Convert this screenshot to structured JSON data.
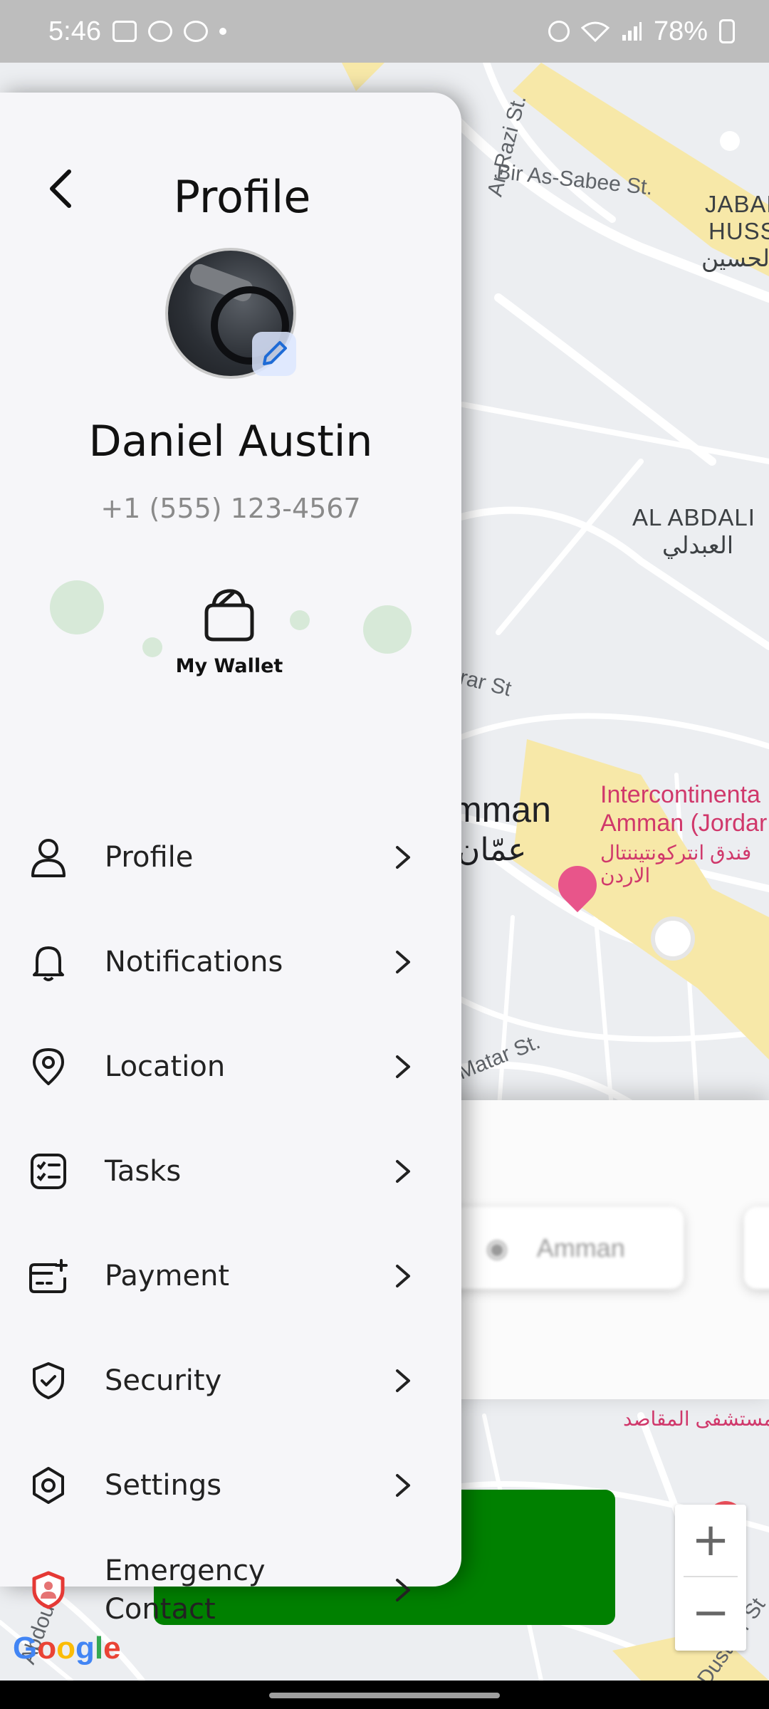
{
  "status_bar": {
    "time": "5:46",
    "battery": "78%"
  },
  "map": {
    "labels": {
      "bir_as_sabee": "Bir As-Sabee St.",
      "ar_razi": "Ar-Razi St.",
      "jabal_1": "JABAL",
      "jabal_2": "HUSSE",
      "jabal_ar": "الحسين",
      "abdali": "AL ABDALI",
      "abdali_ar": "العبدلي",
      "rar_st": "rar St",
      "amman": "mman",
      "amman_ar": "عمّان",
      "hotel_1": "Intercontinenta",
      "hotel_2": "Amman (Jordar",
      "hotel_ar_1": "فندق انتركونتيننتال",
      "hotel_ar_2": "الاردن",
      "matar_st": "Matar St.",
      "hospital_ar": "مستشفى المقاصد",
      "ad_dustour": "Ad-Dustour St",
      "abdou": "Abdou"
    },
    "sheet_chip_text": "Amman",
    "google": [
      "G",
      "o",
      "o",
      "g",
      "l",
      "e"
    ],
    "zoom_in": "+",
    "zoom_out": "−"
  },
  "drawer": {
    "title": "Profile",
    "user_name": "Daniel Austin",
    "user_phone": "+1 (555) 123-4567",
    "wallet_label": "My Wallet",
    "menu": [
      {
        "label": "Profile",
        "icon": "user-icon"
      },
      {
        "label": "Notifications",
        "icon": "bell-icon"
      },
      {
        "label": "Location",
        "icon": "location-pin-icon"
      },
      {
        "label": "Tasks",
        "icon": "tasks-icon"
      },
      {
        "label": "Payment",
        "icon": "payment-card-icon"
      },
      {
        "label": "Security",
        "icon": "shield-check-icon"
      },
      {
        "label": "Settings",
        "icon": "settings-icon"
      },
      {
        "label": "Emergency Contact",
        "label_line1": "Emergency",
        "label_line2": "Contact",
        "icon": "emergency-shield-icon"
      }
    ]
  },
  "colors": {
    "accent_green": "#008000",
    "bubble_green": "#d7e9d8",
    "emergency_red": "#e53935",
    "edit_blue": "#1e6bd6"
  }
}
